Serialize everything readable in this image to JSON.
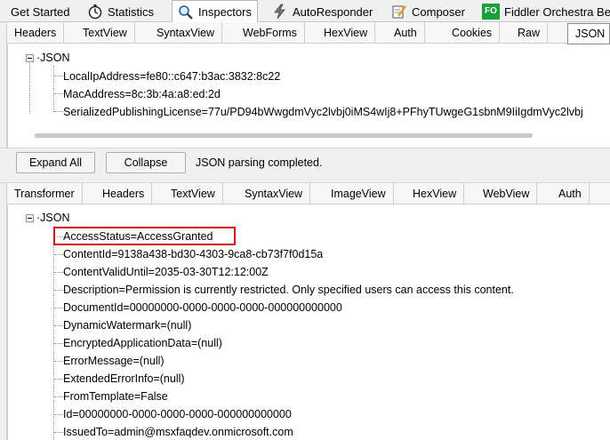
{
  "top_tabs": [
    {
      "label": "Get Started"
    },
    {
      "label": "Statistics"
    },
    {
      "label": "Inspectors"
    },
    {
      "label": "AutoResponder"
    },
    {
      "label": "Composer"
    },
    {
      "label": "Fiddler Orchestra Be",
      "badge": "FO"
    }
  ],
  "request_tabs": [
    "Headers",
    "TextView",
    "SyntaxView",
    "WebForms",
    "HexView",
    "Auth",
    "Cookies",
    "Raw",
    "JSON"
  ],
  "request_tree": {
    "root": "JSON",
    "items": [
      "LocalIpAddress=fe80::c647:b3ac:3832:8c22",
      "MacAddress=8c:3b:4a:a8:ed:2d",
      "SerializedPublishingLicense=77u/PD94bWwgdmVyc2lvbj0iMS4wIj8+PFhyTUwgeG1sbnM9IiIgdmVyc2lvbj"
    ]
  },
  "buttons": {
    "expand_all": "Expand All",
    "collapse": "Collapse"
  },
  "status": "JSON parsing completed.",
  "response_tabs": [
    "Transformer",
    "Headers",
    "TextView",
    "SyntaxView",
    "ImageView",
    "HexView",
    "WebView",
    "Auth"
  ],
  "response_tree": {
    "root": "JSON",
    "items": [
      "AccessStatus=AccessGranted",
      "ContentId=9138a438-bd30-4303-9ca8-cb73f7f0d15a",
      "ContentValidUntil=2035-03-30T12:12:00Z",
      "Description=Permission is currently restricted. Only specified users can access this content.",
      "DocumentId=00000000-0000-0000-0000-000000000000",
      "DynamicWatermark=(null)",
      "EncryptedApplicationData=(null)",
      "ErrorMessage=(null)",
      "ExtendedErrorInfo=(null)",
      "FromTemplate=False",
      "Id=00000000-0000-0000-0000-000000000000",
      "IssuedTo=admin@msxfaqdev.onmicrosoft.com"
    ]
  },
  "colors": {
    "highlight": "#d01010",
    "fo_badge": "#1a9e3a"
  }
}
